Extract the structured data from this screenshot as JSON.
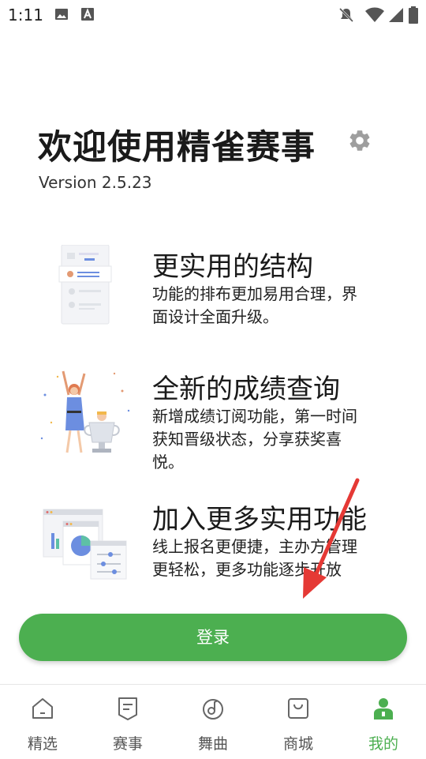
{
  "status_bar": {
    "time": "1:11"
  },
  "header": {
    "title": "欢迎使用精雀赛事",
    "version": "Version 2.5.23"
  },
  "features": [
    {
      "title": "更实用的结构",
      "description": "功能的排布更加易用合理，界面设计全面升级。"
    },
    {
      "title": "全新的成绩查询",
      "description": "新增成绩订阅功能，第一时间获知晋级状态，分享获奖喜悦。"
    },
    {
      "title": "加入更多实用功能",
      "description": "线上报名更便捷，主办方管理更轻松，更多功能逐步开放"
    }
  ],
  "login_button": {
    "label": "登录"
  },
  "nav": {
    "items": [
      {
        "label": "精选",
        "icon": "home-icon"
      },
      {
        "label": "赛事",
        "icon": "document-icon"
      },
      {
        "label": "舞曲",
        "icon": "music-icon"
      },
      {
        "label": "商城",
        "icon": "shopping-bag-icon"
      },
      {
        "label": "我的",
        "icon": "user-icon"
      }
    ],
    "active_index": 4
  },
  "colors": {
    "accent": "#4caf50",
    "arrow": "#e53935"
  }
}
